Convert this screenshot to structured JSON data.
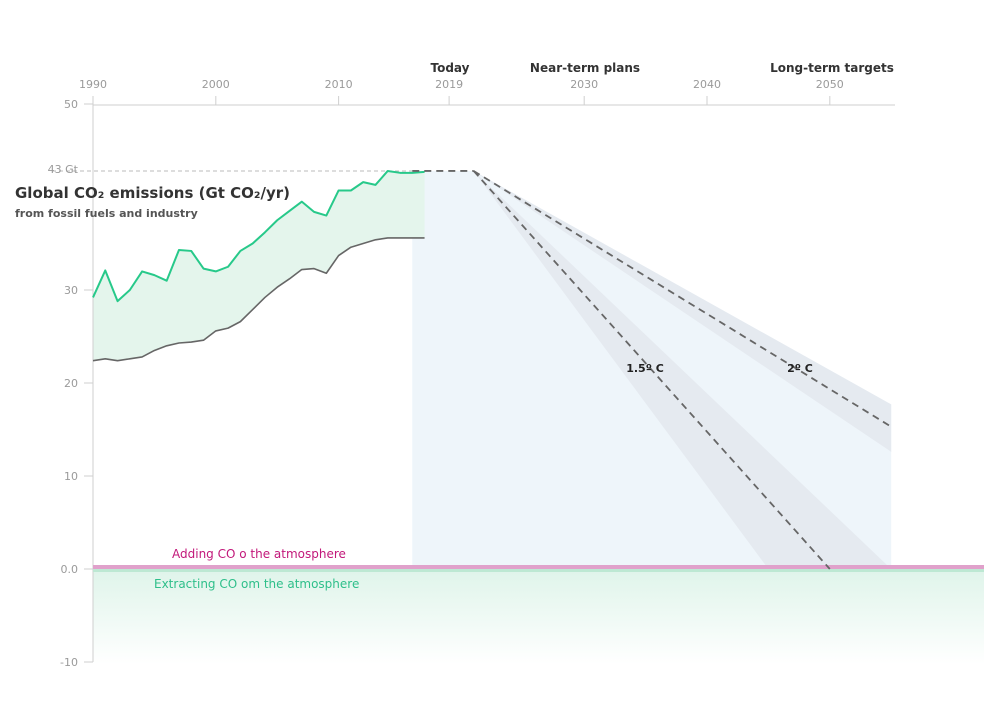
{
  "chart_data": {
    "type": "line",
    "title": "Global CO₂ emissions (Gt CO₂/yr)",
    "subtitle": "from fossil fuels and industry",
    "x_ticks": [
      "1990",
      "2000",
      "2010",
      "2019",
      "2030",
      "2040",
      "2050"
    ],
    "era_labels": [
      "Today",
      "Near-term plans",
      "Long-term targets"
    ],
    "y_ticks": [
      "50",
      "43 Gt",
      "30",
      "20",
      "10",
      "0.0",
      "-10"
    ],
    "ylim": [
      -10,
      50
    ],
    "xlim": [
      1990,
      2055
    ],
    "zone_labels": {
      "positive": "Adding CO o the atmosphere",
      "negative": "Extracting CO om the atmosphere"
    },
    "annotations": [
      "1.5º C",
      "2º C"
    ],
    "series": [
      {
        "name": "",
        "kind": "upper",
        "x": [
          1990,
          1991,
          1992,
          1993,
          1994,
          1995,
          1996,
          1997,
          1998,
          1999,
          2000,
          2001,
          2002,
          2003,
          2004,
          2005,
          2006,
          2007,
          2008,
          2009,
          2010,
          2011,
          2012,
          2013,
          2014,
          2015,
          2016,
          2017
        ],
        "y": [
          29.2,
          32.1,
          28.8,
          30.0,
          32.0,
          31.6,
          31.0,
          34.3,
          34.2,
          32.3,
          32.0,
          32.5,
          34.2,
          35.0,
          36.2,
          37.5,
          38.5,
          39.5,
          38.4,
          38.0,
          40.7,
          40.7,
          41.6,
          41.3,
          42.8,
          42.6,
          42.6,
          42.7
        ]
      },
      {
        "name": "",
        "kind": "lower",
        "x": [
          1990,
          1991,
          1992,
          1993,
          1994,
          1995,
          1996,
          1997,
          1998,
          1999,
          2000,
          2001,
          2002,
          2003,
          2004,
          2005,
          2006,
          2007,
          2008,
          2009,
          2010,
          2011,
          2012,
          2013,
          2014,
          2015,
          2016,
          2017
        ],
        "y": [
          22.4,
          22.6,
          22.4,
          22.6,
          22.8,
          23.5,
          24.0,
          24.3,
          24.4,
          24.6,
          25.6,
          25.9,
          26.6,
          27.9,
          29.2,
          30.3,
          31.2,
          32.2,
          32.3,
          31.8,
          33.7,
          34.6,
          35.0,
          35.4,
          35.6,
          35.6,
          35.6,
          35.6
        ]
      },
      {
        "name": "",
        "kind": "projection-flat",
        "x": [
          2016,
          2021
        ],
        "y": [
          42.8,
          42.8
        ]
      },
      {
        "name": "1.5º C",
        "kind": "pathway",
        "x": [
          2021,
          2050
        ],
        "y": [
          42.8,
          0
        ],
        "band": {
          "x_start": 2021,
          "upper_end": 0,
          "lower_end_x": 2045
        }
      },
      {
        "name": "2º C",
        "kind": "pathway",
        "x": [
          2021,
          2055
        ],
        "y": [
          42.8,
          15.3
        ],
        "band": {
          "upper_end": 17.7,
          "lower_end": 12.6
        }
      }
    ]
  },
  "colors": {
    "upper_line": "#27c98a",
    "lower_line": "#666666",
    "range_fill": "#e4f5ec",
    "future_fill": "#eef5fa",
    "pathway_band": "#e5eaf0",
    "pathway_line": "#666666",
    "pink_band": "#e0a1cb",
    "green_band": "#bde8d3"
  }
}
